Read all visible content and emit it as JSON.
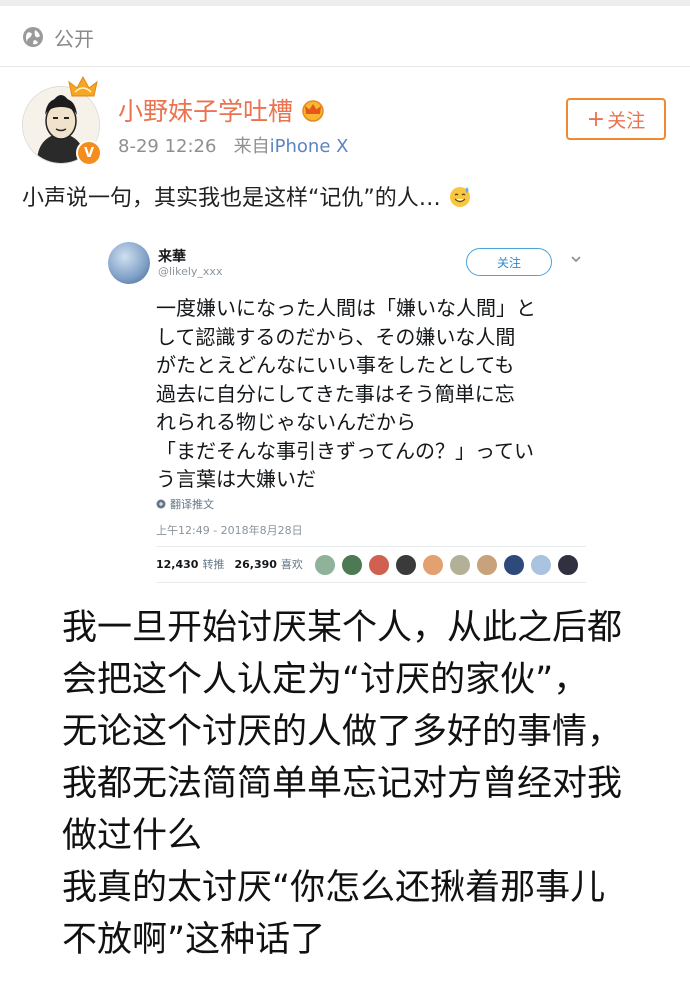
{
  "header": {
    "visibility_label": "公开"
  },
  "post": {
    "author": "小野妹子学吐槽",
    "time": "8-29 12:26",
    "source_prefix": "来自",
    "source": "iPhone X",
    "follow_label": "关注",
    "text": "小声说一句，其实我也是这样“记仇”的人…"
  },
  "tweet": {
    "name": "来華",
    "handle": "@likely_xxx",
    "follow_label": "关注",
    "body_lines": [
      "一度嫌いになった人間は「嫌いな人間」と",
      "して認識するのだから、その嫌いな人間",
      "がたとえどんなにいい事をしたとしても",
      "過去に自分にしてきた事はそう簡単に忘",
      "れられる物じゃないんだから",
      "「まだそんな事引きずってんの？」ってい",
      "う言葉は大嫌いだ"
    ],
    "translate_label": "翻译推文",
    "timestamp": "上午12:49 - 2018年8月28日",
    "retweets": "12,430",
    "retweets_label": "转推",
    "likes": "26,390",
    "likes_label": "喜欢",
    "liker_colors": [
      "#8fb39a",
      "#4d7a52",
      "#d06050",
      "#3a3a3a",
      "#e3a070",
      "#b4b098",
      "#c7a27a",
      "#2e4a7a",
      "#a9c3e0",
      "#303040"
    ]
  },
  "translation_lines": [
    "我一旦开始讨厌某个人，从此之后都",
    "会把这个人认定为“讨厌的家伙”，",
    "无论这个讨厌的人做了多好的事情，",
    "我都无法简简单单忘记对方曾经对我",
    "做过什么",
    "我真的太讨厌“你怎么还揪着那事儿",
    "不放啊”这种话了"
  ],
  "colors": {
    "accent": "#eb7350",
    "source_link": "#5a84c2",
    "twitter_blue": "#2b8ad0"
  },
  "icons": [
    "globe-icon",
    "crown-icon",
    "verified-badge-icon",
    "sweat-smile-emoji-icon",
    "chevron-down-icon",
    "translate-icon"
  ]
}
